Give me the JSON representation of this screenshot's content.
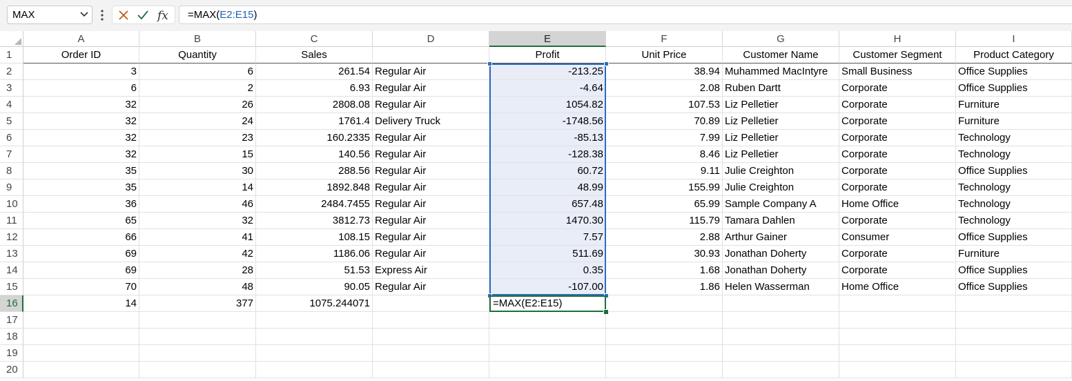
{
  "name_box": {
    "value": "MAX"
  },
  "formula_bar": {
    "prefix": "=MAX(",
    "range": "E2:E15",
    "suffix": ")"
  },
  "columns": [
    "A",
    "B",
    "C",
    "D",
    "E",
    "F",
    "G",
    "H",
    "I"
  ],
  "rows": [
    "1",
    "2",
    "3",
    "4",
    "5",
    "6",
    "7",
    "8",
    "9",
    "10",
    "11",
    "12",
    "13",
    "14",
    "15",
    "16",
    "17",
    "18",
    "19",
    "20"
  ],
  "headers": [
    "Order ID",
    "Quantity",
    "Sales",
    "",
    "Profit",
    "Unit Price",
    "Customer Name",
    "Customer Segment",
    "Product Category"
  ],
  "data": [
    [
      "3",
      "6",
      "261.54",
      "Regular Air",
      "-213.25",
      "38.94",
      "Muhammed MacIntyre",
      "Small Business",
      "Office Supplies"
    ],
    [
      "6",
      "2",
      "6.93",
      "Regular Air",
      "-4.64",
      "2.08",
      "Ruben Dartt",
      "Corporate",
      "Office Supplies"
    ],
    [
      "32",
      "26",
      "2808.08",
      "Regular Air",
      "1054.82",
      "107.53",
      "Liz Pelletier",
      "Corporate",
      "Furniture"
    ],
    [
      "32",
      "24",
      "1761.4",
      "Delivery Truck",
      "-1748.56",
      "70.89",
      "Liz Pelletier",
      "Corporate",
      "Furniture"
    ],
    [
      "32",
      "23",
      "160.2335",
      "Regular Air",
      "-85.13",
      "7.99",
      "Liz Pelletier",
      "Corporate",
      "Technology"
    ],
    [
      "32",
      "15",
      "140.56",
      "Regular Air",
      "-128.38",
      "8.46",
      "Liz Pelletier",
      "Corporate",
      "Technology"
    ],
    [
      "35",
      "30",
      "288.56",
      "Regular Air",
      "60.72",
      "9.11",
      "Julie Creighton",
      "Corporate",
      "Office Supplies"
    ],
    [
      "35",
      "14",
      "1892.848",
      "Regular Air",
      "48.99",
      "155.99",
      "Julie Creighton",
      "Corporate",
      "Technology"
    ],
    [
      "36",
      "46",
      "2484.7455",
      "Regular Air",
      "657.48",
      "65.99",
      "Sample Company A",
      "Home Office",
      "Technology"
    ],
    [
      "65",
      "32",
      "3812.73",
      "Regular Air",
      "1470.30",
      "115.79",
      "Tamara Dahlen",
      "Corporate",
      "Technology"
    ],
    [
      "66",
      "41",
      "108.15",
      "Regular Air",
      "7.57",
      "2.88",
      "Arthur Gainer",
      "Consumer",
      "Office Supplies"
    ],
    [
      "69",
      "42",
      "1186.06",
      "Regular Air",
      "511.69",
      "30.93",
      "Jonathan Doherty",
      "Corporate",
      "Furniture"
    ],
    [
      "69",
      "28",
      "51.53",
      "Express Air",
      "0.35",
      "1.68",
      "Jonathan Doherty",
      "Corporate",
      "Office Supplies"
    ],
    [
      "70",
      "48",
      "90.05",
      "Regular Air",
      "-107.00",
      "1.86",
      "Helen Wasserman",
      "Home Office",
      "Office Supplies"
    ]
  ],
  "summary_row": [
    "14",
    "377",
    "1075.244071",
    "",
    "=MAX(E2:E15)",
    "",
    "",
    "",
    ""
  ],
  "colors": {
    "accent_green": "#1e6e3a",
    "selection_blue": "#2d6cc0",
    "selection_fill": "#e8edf7",
    "cancel_orange": "#c55a11"
  }
}
